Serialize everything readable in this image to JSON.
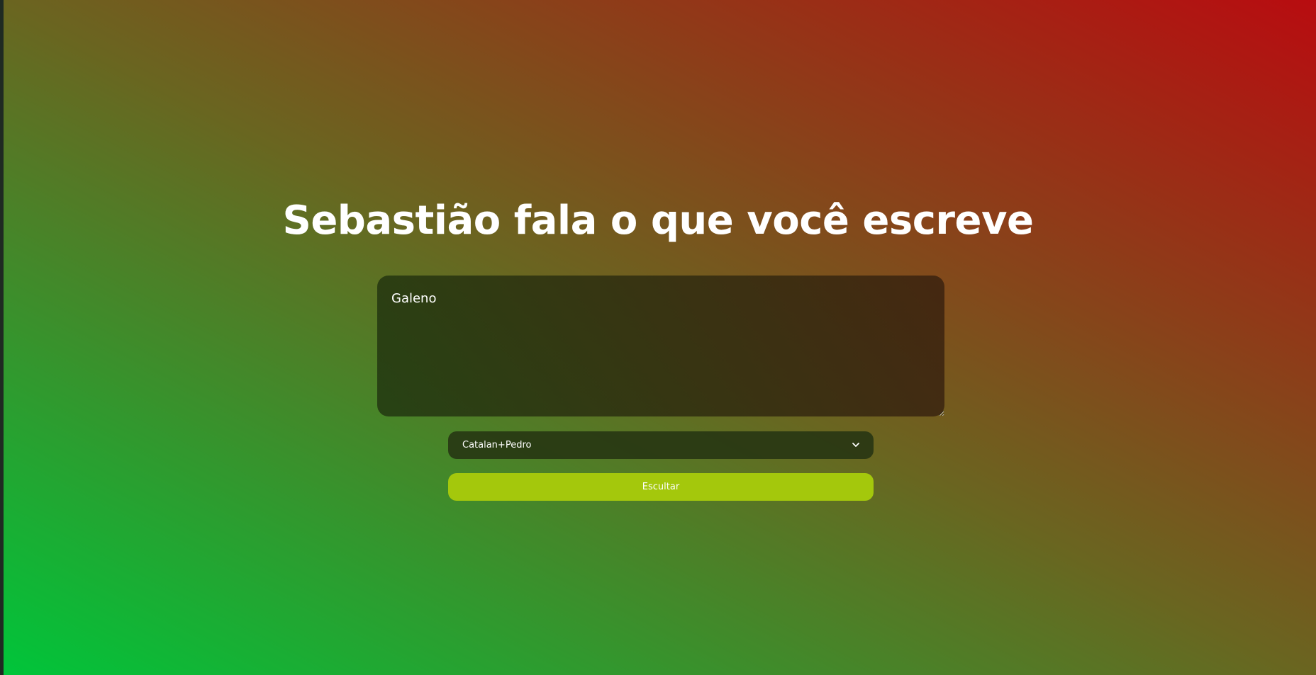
{
  "page": {
    "title": "Sebastião fala o que você escreve"
  },
  "form": {
    "text_value": "Galeno",
    "voice_select": {
      "selected": "Catalan+Pedro",
      "icon": "chevron-down-icon"
    },
    "listen_label": "Escultar"
  },
  "colors": {
    "gradient_start": "#00c53a",
    "gradient_end": "#b80c10",
    "button": "#a4c80c"
  }
}
